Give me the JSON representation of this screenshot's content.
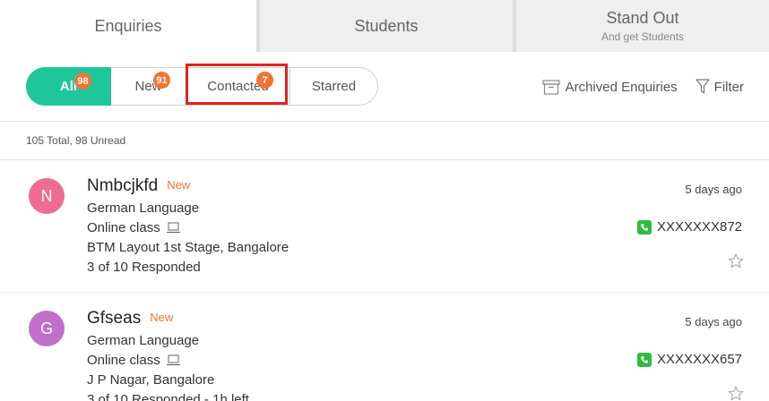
{
  "tabs": [
    {
      "label": "Enquiries"
    },
    {
      "label": "Students"
    },
    {
      "label": "Stand Out",
      "sub": "And get Students"
    }
  ],
  "filters": [
    {
      "label": "All",
      "count": "98"
    },
    {
      "label": "New",
      "count": "91"
    },
    {
      "label": "Contacted",
      "count": "7"
    },
    {
      "label": "Starred"
    }
  ],
  "tools": {
    "archived_label": "Archived Enquiries",
    "filter_label": "Filter"
  },
  "summary": "105 Total, 98 Unread",
  "enquiries": [
    {
      "initial": "N",
      "name": "Nmbcjkfd",
      "tag": "New",
      "avatar_color": "#ef6b93",
      "course": "German Language",
      "mode": "Online class",
      "location": "BTM Layout 1st Stage, Bangalore",
      "responded": "3 of 10 Responded",
      "time": "5 days ago",
      "phone": "XXXXXXX872"
    },
    {
      "initial": "G",
      "name": "Gfseas",
      "tag": "New",
      "avatar_color": "#c070c9",
      "course": "German Language",
      "mode": "Online class",
      "location": "J P Nagar, Bangalore",
      "responded": "3 of 10 Responded - 1h left",
      "time": "5 days ago",
      "phone": "XXXXXXX657"
    }
  ],
  "colors": {
    "accent": "#1ec79a",
    "badge": "#f07532",
    "highlight": "#e2231a",
    "phone_icon": "#2dbb3f"
  }
}
